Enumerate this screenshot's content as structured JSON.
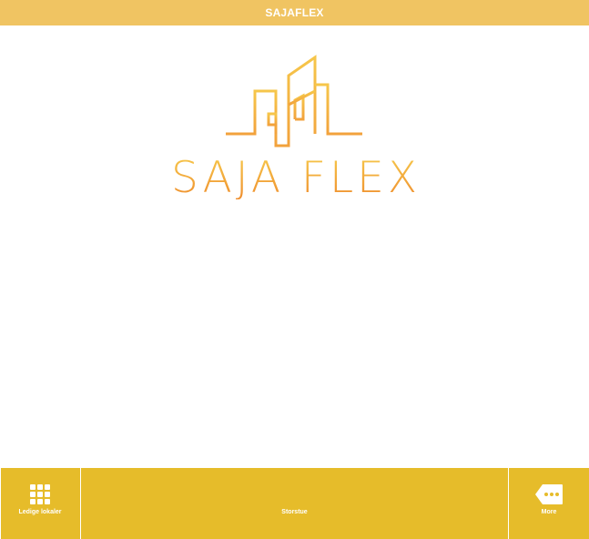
{
  "header": {
    "title": "SAJAFLEX"
  },
  "logo": {
    "text": "SAJA FLEX",
    "icon": "city-buildings-logo"
  },
  "tabbar": {
    "tabs": [
      {
        "label": "Ledige lokaler",
        "icon": "grid-icon"
      },
      {
        "label": "Storstue",
        "icon": ""
      },
      {
        "label": "More",
        "icon": "more-dots-icon"
      }
    ]
  },
  "colors": {
    "header_bg": "#f0c462",
    "tabbar_bg": "#e6bc2a",
    "logo_gradient_top": "#f6c64a",
    "logo_gradient_bottom": "#ef8e2e"
  }
}
